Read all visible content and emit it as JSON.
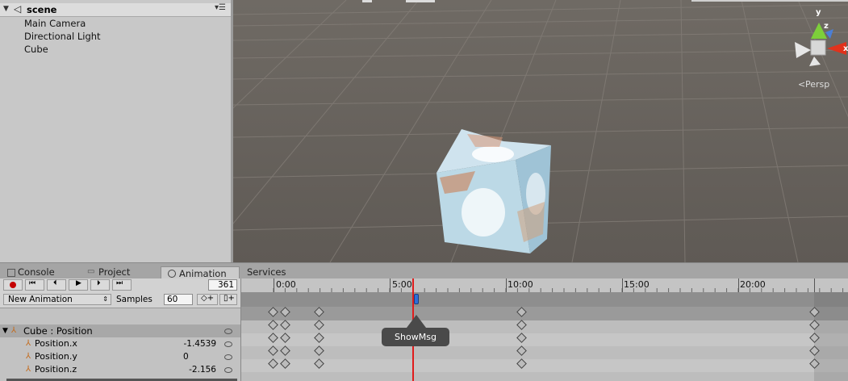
{
  "hierarchy": {
    "scene_name": "scene",
    "items": [
      "Main Camera",
      "Directional Light",
      "Cube"
    ]
  },
  "scene_view": {
    "persp_label": "Persp",
    "gizmo_y": "y",
    "gizmo_z": "z",
    "gizmo_x": "x"
  },
  "tabs": [
    {
      "label": "Console",
      "icon": "console-icon"
    },
    {
      "label": "Project",
      "icon": "folder-icon"
    },
    {
      "label": "Animation",
      "icon": "clock-icon",
      "active": true
    },
    {
      "label": "Services"
    }
  ],
  "animation": {
    "frame": "361",
    "clip_name": "New Animation",
    "samples_label": "Samples",
    "samples_value": "60",
    "group_label": "Cube : Position",
    "properties": [
      {
        "name": "Position.x",
        "value": "-1.4539"
      },
      {
        "name": "Position.y",
        "value": "0"
      },
      {
        "name": "Position.z",
        "value": "-2.156"
      }
    ],
    "ruler_labels": [
      "0:00",
      "5:00",
      "10:00",
      "15:00",
      "20:00"
    ],
    "event_tooltip": "ShowMsg"
  },
  "colors": {
    "record": "#c40000",
    "playhead": "#e01c1c",
    "gizmo_y": "#7dcf3a",
    "gizmo_x": "#e0321c"
  }
}
